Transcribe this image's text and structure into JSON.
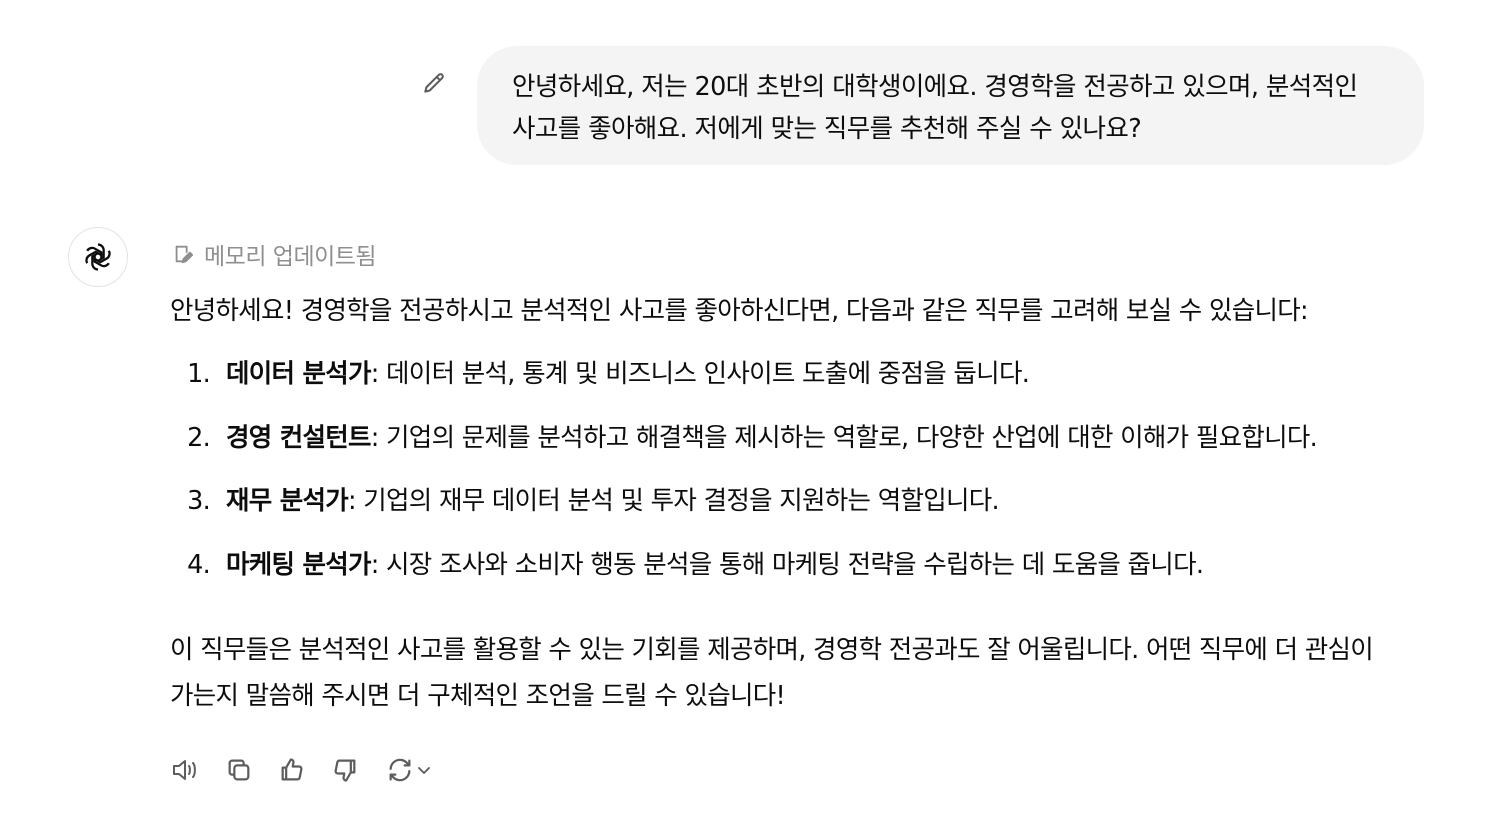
{
  "user_message": {
    "text": "안녕하세요, 저는 20대 초반의 대학생이에요. 경영학을 전공하고 있으며, 분석적인 사고를 좋아해요. 저에게 맞는 직무를 추천해 주실 수 있나요?",
    "edit_icon": "pencil-icon"
  },
  "assistant": {
    "avatar_icon": "openai-logo-icon",
    "memory_label": "메모리 업데이트됨",
    "memory_icon": "memory-note-icon",
    "intro": "안녕하세요! 경영학을 전공하시고 분석적인 사고를 좋아하신다면, 다음과 같은 직무를 고려해 보실 수 있습니다:",
    "jobs": [
      {
        "num": "1.",
        "title": "데이터 분석가",
        "desc": ": 데이터 분석, 통계 및 비즈니스 인사이트 도출에 중점을 둡니다."
      },
      {
        "num": "2.",
        "title": "경영 컨설턴트",
        "desc": ": 기업의 문제를 분석하고 해결책을 제시하는 역할로, 다양한 산업에 대한 이해가 필요합니다."
      },
      {
        "num": "3.",
        "title": "재무 분석가",
        "desc": ": 기업의 재무 데이터 분석 및 투자 결정을 지원하는 역할입니다."
      },
      {
        "num": "4.",
        "title": "마케팅 분석가",
        "desc": ": 시장 조사와 소비자 행동 분석을 통해 마케팅 전략을 수립하는 데 도움을 줍니다."
      }
    ],
    "outro": "이 직무들은 분석적인 사고를 활용할 수 있는 기회를 제공하며, 경영학 전공과도 잘 어울립니다. 어떤 직무에 더 관심이 가는지 말씀해 주시면 더 구체적인 조언을 드릴 수 있습니다!"
  },
  "actions": [
    {
      "name": "read-aloud-icon"
    },
    {
      "name": "copy-icon"
    },
    {
      "name": "thumbs-up-icon"
    },
    {
      "name": "thumbs-down-icon"
    },
    {
      "name": "regenerate-icon"
    }
  ],
  "colors": {
    "bubble_bg": "#f4f4f4",
    "text": "#0d0d0d",
    "muted": "#8f8f8f"
  }
}
